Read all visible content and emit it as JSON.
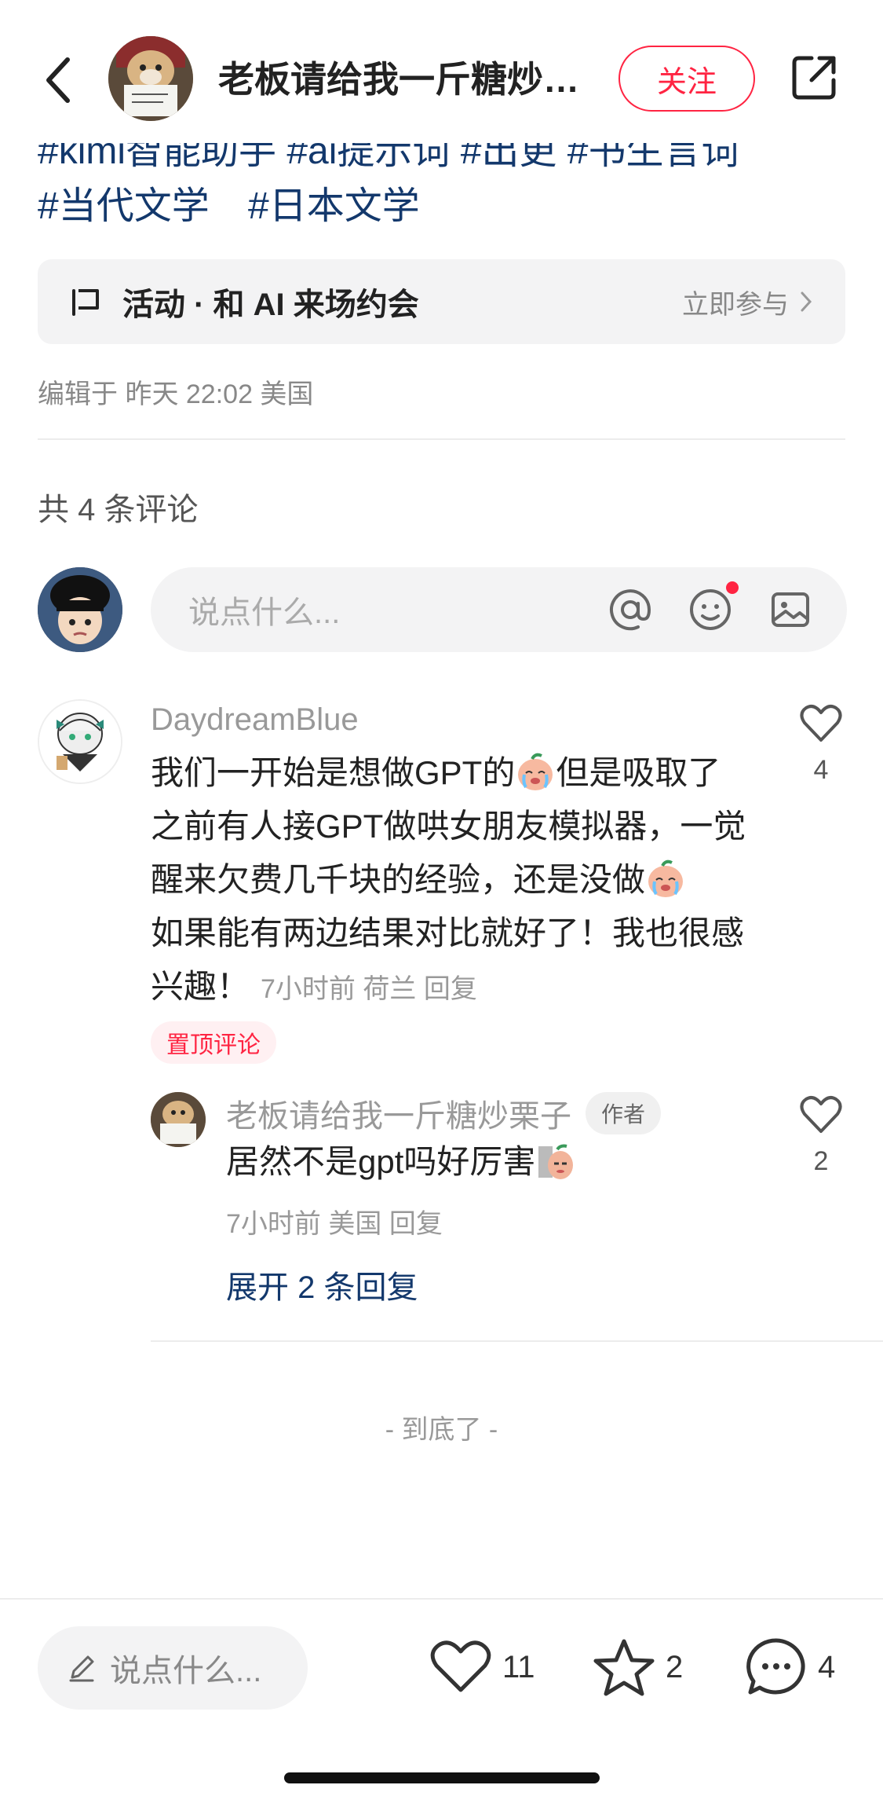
{
  "header": {
    "title": "老板请给我一斤糖炒栗子",
    "follow_label": "关注"
  },
  "tags": {
    "cut_row": "#kimi智能助手   #ai提示词   #出更   #书生言词",
    "items": [
      "#当代文学",
      "#日本文学"
    ]
  },
  "activity": {
    "label": "活动 · 和 AI 来场约会",
    "join_label": "立即参与"
  },
  "edited": "编辑于 昨天 22:02 美国",
  "comments_count": "共 4 条评论",
  "comment_input": {
    "placeholder": "说点什么..."
  },
  "comment": {
    "user": "DaydreamBlue",
    "text_part1": "我们一开始是想做GPT的",
    "text_part2": "但是吸取了之前有人接GPT做哄女朋友模拟器，一觉醒来欠费几千块的经验，还是没做",
    "text_part3": "如果能有两边结果对比就好了！我也很感兴趣！",
    "time": "7小时前",
    "location": "荷兰",
    "reply_label": "回复",
    "likes": "4",
    "pin_label": "置顶评论"
  },
  "reply": {
    "user": "老板请给我一斤糖炒栗子",
    "author_tag": "作者",
    "text": "居然不是gpt吗好厉害",
    "time": "7小时前",
    "location": "美国",
    "reply_label": "回复",
    "likes": "2",
    "expand_label": "展开 2 条回复"
  },
  "end_label": "- 到底了 -",
  "bottom_bar": {
    "input_placeholder": "说点什么...",
    "likes": "11",
    "favorites": "2",
    "comments": "4"
  },
  "colors": {
    "accent": "#ff2442",
    "tag": "#13386c",
    "muted": "#999999"
  }
}
